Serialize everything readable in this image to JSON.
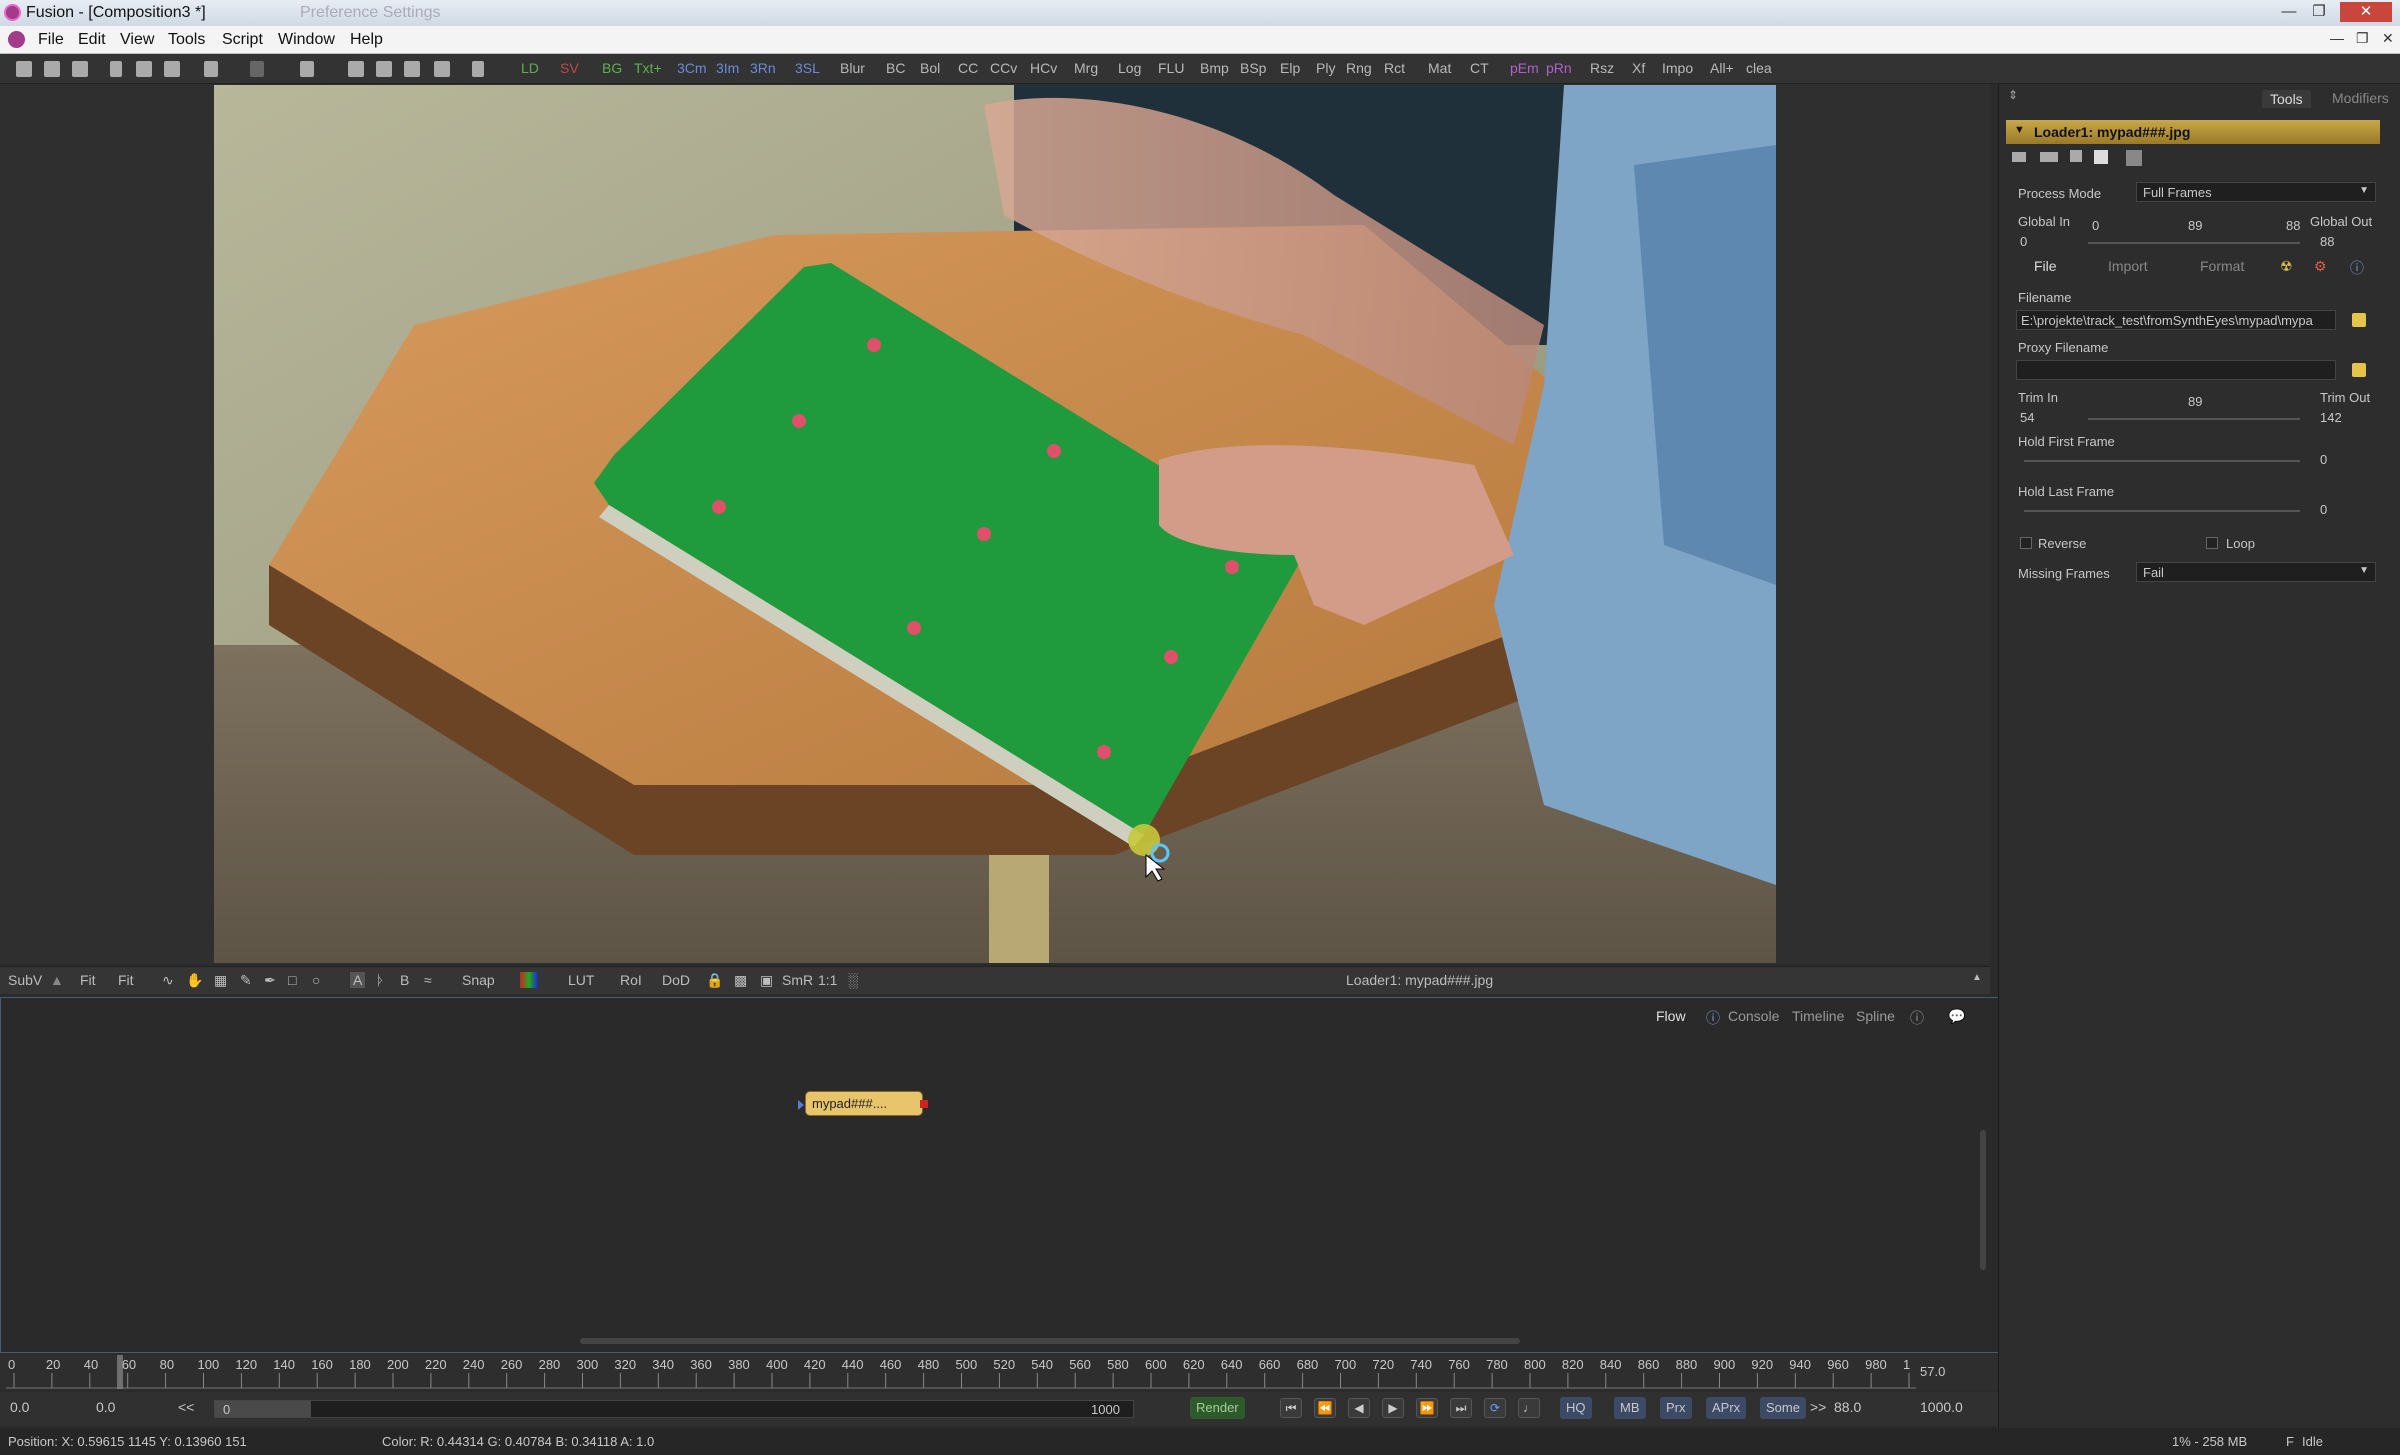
{
  "window": {
    "title": "Fusion - [Composition3 *]",
    "faded_title": "Preference Settings"
  },
  "menu": [
    "File",
    "Edit",
    "View",
    "Tools",
    "Script",
    "Window",
    "Help"
  ],
  "toolbar": {
    "buttons": [
      {
        "label": "LD",
        "color": "green"
      },
      {
        "label": "SV",
        "color": "red"
      },
      {
        "label": "BG",
        "color": "green"
      },
      {
        "label": "Txt+",
        "color": "green"
      },
      {
        "label": "3Cm",
        "color": "blue"
      },
      {
        "label": "3Im",
        "color": "blue"
      },
      {
        "label": "3Rn",
        "color": "blue"
      },
      {
        "label": "3SL",
        "color": "blue"
      },
      {
        "label": "Blur",
        "color": ""
      },
      {
        "label": "BC",
        "color": ""
      },
      {
        "label": "Bol",
        "color": ""
      },
      {
        "label": "CC",
        "color": ""
      },
      {
        "label": "CCv",
        "color": ""
      },
      {
        "label": "HCv",
        "color": ""
      },
      {
        "label": "Mrg",
        "color": ""
      },
      {
        "label": "Log",
        "color": ""
      },
      {
        "label": "FLU",
        "color": ""
      },
      {
        "label": "Bmp",
        "color": ""
      },
      {
        "label": "BSp",
        "color": ""
      },
      {
        "label": "Elp",
        "color": ""
      },
      {
        "label": "Ply",
        "color": ""
      },
      {
        "label": "Rng",
        "color": ""
      },
      {
        "label": "Rct",
        "color": ""
      },
      {
        "label": "Mat",
        "color": ""
      },
      {
        "label": "CT",
        "color": ""
      },
      {
        "label": "pEm",
        "color": "purple"
      },
      {
        "label": "pRn",
        "color": "purple"
      },
      {
        "label": "Rsz",
        "color": ""
      },
      {
        "label": "Xf",
        "color": ""
      },
      {
        "label": "Impo",
        "color": ""
      },
      {
        "label": "All+",
        "color": ""
      },
      {
        "label": "clea",
        "color": ""
      }
    ]
  },
  "viewer_toolbar": {
    "subv": "SubV",
    "fit1": "Fit",
    "fit2": "Fit",
    "snap": "Snap",
    "lut": "LUT",
    "roi": "RoI",
    "dod": "DoD",
    "smr": "SmR",
    "ratio": "1:1",
    "viewer_label": "Loader1: mypad###.jpg"
  },
  "flow_tabs": [
    "Flow",
    "Console",
    "Timeline",
    "Spline"
  ],
  "node": {
    "label": "mypad###...."
  },
  "timeline": {
    "ticks": [
      "0",
      "20",
      "40",
      "60",
      "80",
      "100",
      "120",
      "140",
      "160",
      "180",
      "200",
      "220",
      "240",
      "260",
      "280",
      "300",
      "320",
      "340",
      "360",
      "380",
      "400",
      "420",
      "440",
      "460",
      "480",
      "500",
      "520",
      "540",
      "560",
      "580",
      "600",
      "620",
      "640",
      "660",
      "680",
      "700",
      "720",
      "740",
      "760",
      "780",
      "800",
      "820",
      "840",
      "860",
      "880",
      "900",
      "920",
      "940",
      "960",
      "980",
      "1"
    ],
    "current_value": "57.0"
  },
  "transport": {
    "start_a": "0.0",
    "start_b": "0.0",
    "range_start": "0",
    "range_end": "1000",
    "render": "Render",
    "hq": "HQ",
    "mb": "MB",
    "prx": "Prx",
    "aprx": "APrx",
    "some": "Some",
    "current": "88.0",
    "end": "1000.0"
  },
  "status": {
    "position": "Position:  X: 0.59615    1145    Y: 0.13960    151",
    "color": "Color: R: 0.44314    G: 0.40784    B: 0.34118    A: 1.0",
    "memory": "1% - 258 MB",
    "state": "Idle"
  },
  "tools_panel": {
    "tabs": [
      "Tools",
      "Modifiers"
    ],
    "header": "Loader1: mypad###.jpg",
    "process_mode_label": "Process Mode",
    "process_mode_value": "Full Frames",
    "global_in_label": "Global In",
    "global_in_value": "0",
    "global_out_label": "Global Out",
    "global_out_value": "88",
    "global_range_a": "0",
    "global_range_mid": "89",
    "global_range_b": "88",
    "subtabs": [
      "File",
      "Import",
      "Format"
    ],
    "filename_label": "Filename",
    "filename_value": "E:\\projekte\\track_test\\fromSynthEyes\\mypad\\mypa",
    "proxy_label": "Proxy Filename",
    "trim_in_label": "Trim In",
    "trim_in_value": "54",
    "trim_mid": "89",
    "trim_out_label": "Trim Out",
    "trim_out_value": "142",
    "hold_first_label": "Hold First Frame",
    "hold_first_value": "0",
    "hold_last_label": "Hold Last Frame",
    "hold_last_value": "0",
    "reverse_label": "Reverse",
    "loop_label": "Loop",
    "missing_label": "Missing Frames",
    "missing_value": "Fail"
  },
  "colors": {
    "board": "#1f9a3c",
    "table": "#c98a4c",
    "node": "#e8c46a",
    "tool_header": "#c8a848"
  }
}
